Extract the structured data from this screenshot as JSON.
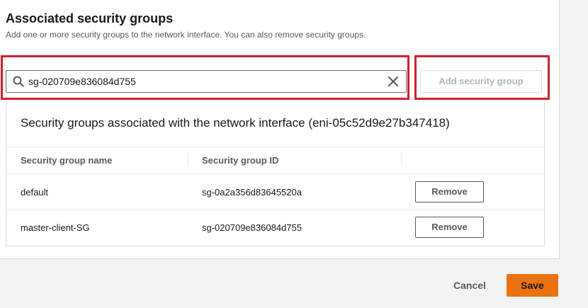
{
  "section": {
    "title": "Associated security groups",
    "description": "Add one or more security groups to the network interface. You can also remove security groups."
  },
  "search": {
    "value": "sg-020709e836084d755",
    "icon": "search-icon",
    "clear_icon": "close-icon"
  },
  "add_button": {
    "label": "Add security group",
    "disabled": true
  },
  "table": {
    "title": "Security groups associated with the network interface (eni-05c52d9e27b347418)",
    "columns": [
      "Security group name",
      "Security group ID",
      ""
    ],
    "rows": [
      {
        "name": "default",
        "id": "sg-0a2a356d83645520a",
        "action": "Remove"
      },
      {
        "name": "master-client-SG",
        "id": "sg-020709e836084d755",
        "action": "Remove"
      }
    ]
  },
  "footer": {
    "cancel_label": "Cancel",
    "save_label": "Save"
  },
  "colors": {
    "highlight": "#d0202f",
    "primary": "#ec7211",
    "text": "#16191f",
    "muted": "#545b64",
    "disabled": "#aab7b8"
  }
}
